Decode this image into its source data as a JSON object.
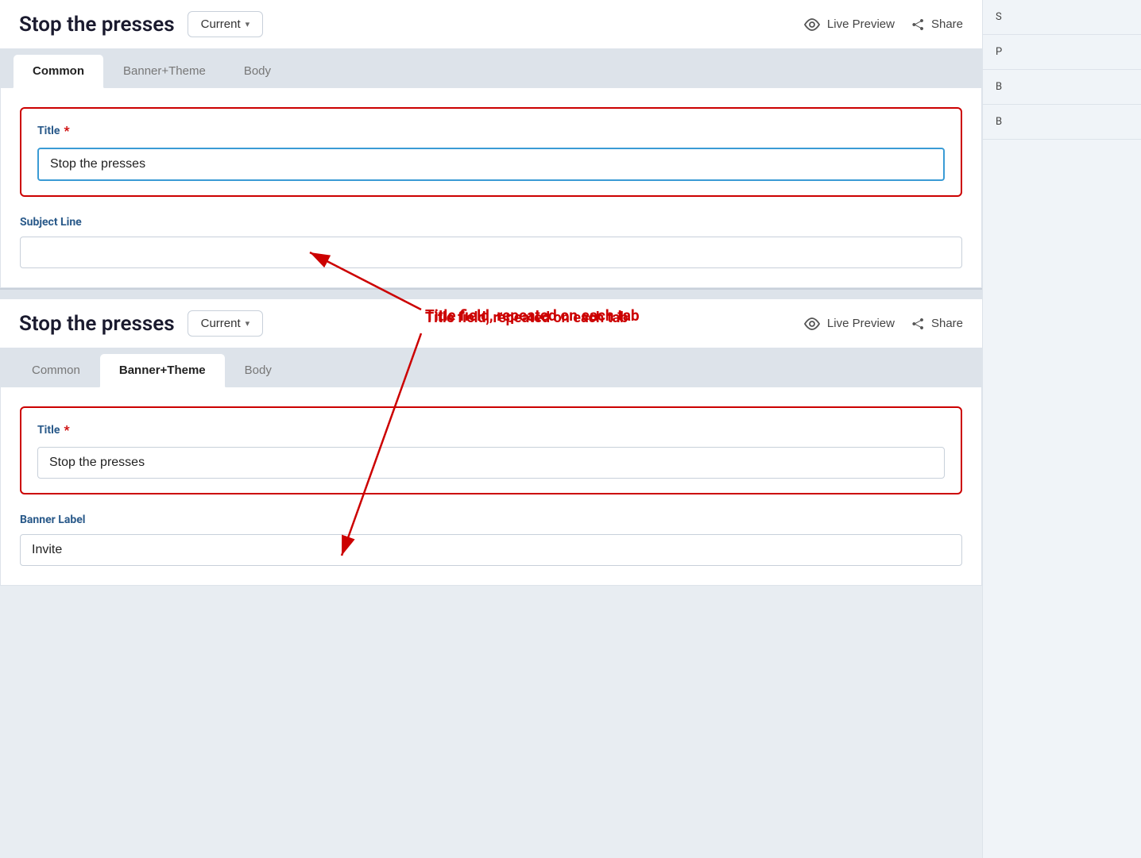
{
  "app": {
    "title": "Stop the presses",
    "version_label": "Current",
    "live_preview_label": "Live Preview",
    "share_label": "Share"
  },
  "tabs_top": {
    "tabs": [
      {
        "id": "common",
        "label": "Common",
        "active": true
      },
      {
        "id": "banner_theme",
        "label": "Banner+Theme",
        "active": false
      },
      {
        "id": "body",
        "label": "Body",
        "active": false
      }
    ]
  },
  "tabs_bottom": {
    "tabs": [
      {
        "id": "common",
        "label": "Common",
        "active": false
      },
      {
        "id": "banner_theme",
        "label": "Banner+Theme",
        "active": true
      },
      {
        "id": "body",
        "label": "Body",
        "active": false
      }
    ]
  },
  "top_panel": {
    "title_label": "Title",
    "title_required": "*",
    "title_value": "Stop the presses",
    "subject_label": "Subject Line",
    "subject_value": ""
  },
  "bottom_panel": {
    "title_label": "Title",
    "title_required": "*",
    "title_value": "Stop the presses",
    "banner_label": "Banner Label",
    "banner_value": "Invite"
  },
  "annotation": {
    "text": "Title field, repeated on each tab"
  },
  "sidebar_top": {
    "items": [
      "S",
      "P",
      "B",
      "B"
    ]
  },
  "sidebar_bottom": {
    "items": [
      "S",
      "P",
      "B"
    ]
  }
}
